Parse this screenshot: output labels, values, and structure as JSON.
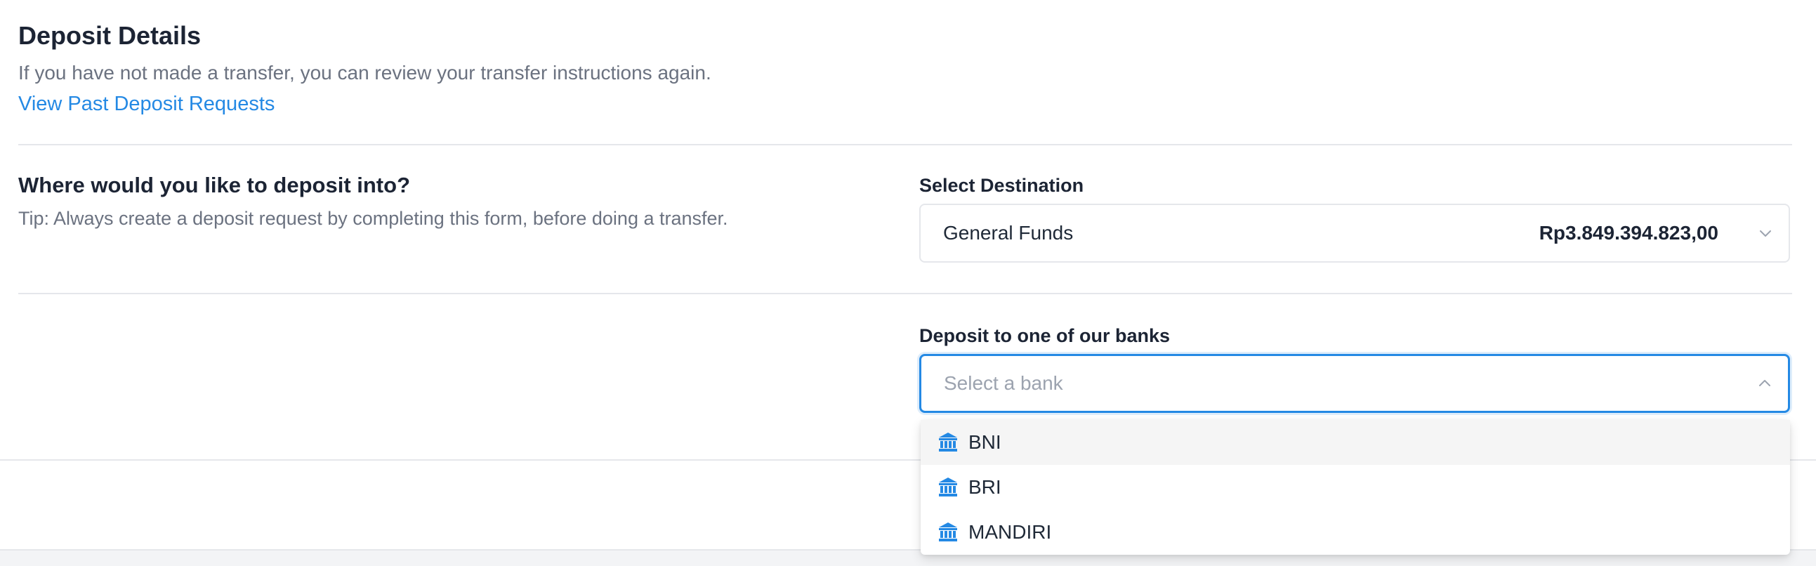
{
  "header": {
    "title": "Deposit Details",
    "subtitle": "If you have not made a transfer, you can review your transfer instructions again.",
    "past_requests_link": "View Past Deposit Requests"
  },
  "question": {
    "title": "Where would you like to deposit into?",
    "tip": "Tip: Always create a deposit request by completing this form, before doing a transfer."
  },
  "destination": {
    "label": "Select Destination",
    "selected_value": "General Funds",
    "balance": "Rp3.849.394.823,00"
  },
  "bank": {
    "label": "Deposit to one of our banks",
    "placeholder": "Select a bank",
    "dropdown_open": true,
    "options": [
      {
        "label": "BNI",
        "icon": "bank-icon",
        "highlighted": true
      },
      {
        "label": "BRI",
        "icon": "bank-icon",
        "highlighted": false
      },
      {
        "label": "MANDIRI",
        "icon": "bank-icon",
        "highlighted": false
      }
    ]
  },
  "colors": {
    "accent": "#2489e4",
    "heading": "#1c2434",
    "muted_text": "#6b7280",
    "divider": "#e5e7eb"
  }
}
